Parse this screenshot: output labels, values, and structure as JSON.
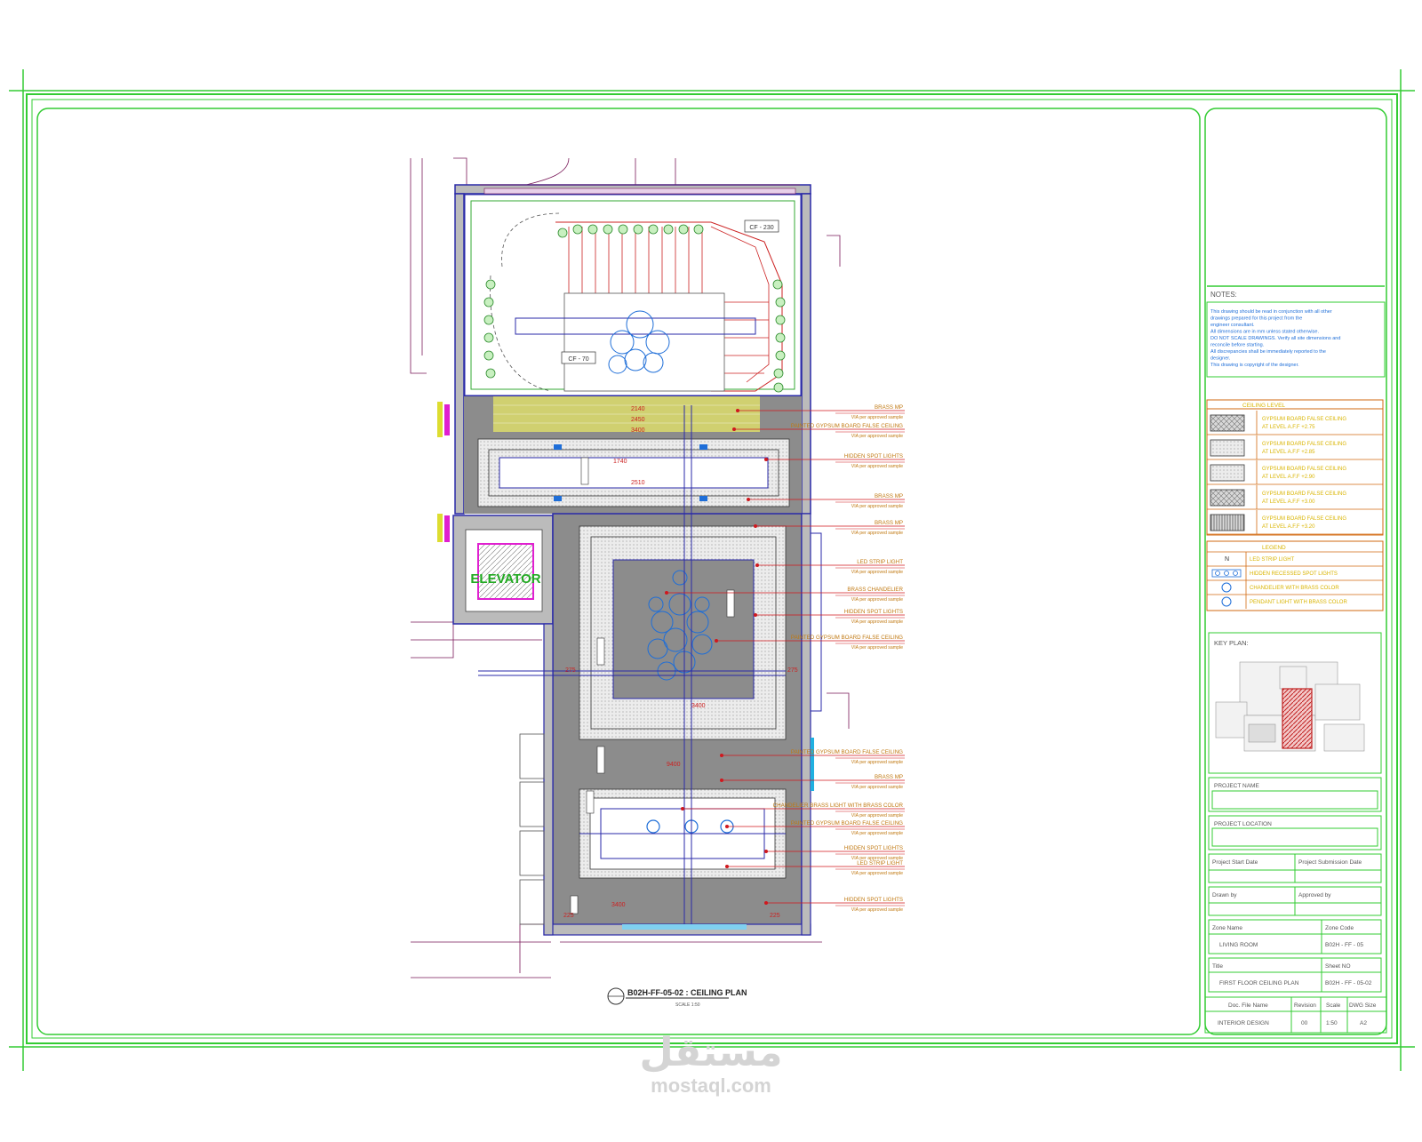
{
  "drawing": {
    "elevator_label": "ELEVATOR",
    "plan_title": "B02H-FF-05-02 : CEILING PLAN",
    "plan_scale": "SCALE 1:50",
    "dimensions": [
      "2140",
      "2450",
      "3400",
      "1740",
      "2510",
      "3400",
      "9400",
      "275",
      "275",
      "225",
      "225",
      "3400"
    ],
    "room_tags": [
      "CF - 230",
      "CF - 70"
    ]
  },
  "annotations": [
    {
      "label": "BRASS MP",
      "note": "VIA per approved sample"
    },
    {
      "label": "PAINTED GYPSUM BOARD FALSE CEILING",
      "note": "VIA per approved sample"
    },
    {
      "label": "HIDDEN SPOT LIGHTS",
      "note": "VIA per approved sample"
    },
    {
      "label": "BRASS MP",
      "note": "VIA per approved sample"
    },
    {
      "label": "BRASS MP",
      "note": "VIA per approved sample"
    },
    {
      "label": "LED STRIP LIGHT",
      "note": "VIA per approved sample"
    },
    {
      "label": "BRASS CHANDELIER",
      "note": "VIA per approved sample"
    },
    {
      "label": "HIDDEN SPOT LIGHTS",
      "note": "VIA per approved sample"
    },
    {
      "label": "PAINTED GYPSUM BOARD FALSE CEILING",
      "note": "VIA per approved sample"
    },
    {
      "label": "PAINTED GYPSUM BOARD FALSE CEILING",
      "note": "VIA per approved sample"
    },
    {
      "label": "BRASS MP",
      "note": "VIA per approved sample"
    },
    {
      "label": "CHANDELIER BRASS LIGHT WITH BRASS COLOR",
      "note": "VIA per approved sample"
    },
    {
      "label": "PAINTED GYPSUM BOARD FALSE CEILING",
      "note": "VIA per approved sample"
    },
    {
      "label": "HIDDEN SPOT LIGHTS",
      "note": "VIA per approved sample"
    },
    {
      "label": "LED STRIP LIGHT",
      "note": "VIA per approved sample"
    },
    {
      "label": "HIDDEN SPOT LIGHTS",
      "note": "VIA per approved sample"
    }
  ],
  "title_block": {
    "notes_title": "NOTES:",
    "notes": [
      "This drawing should be read in conjunction with all other",
      "drawings prepared for this project from the",
      "engineer consultant.",
      "All dimensions are in mm unless stated otherwise.",
      "DO NOT SCALE DRAWINGS. Verify all site dimensions and",
      "reconcile before starting.",
      "All discrepancies shall be immediately reported to the",
      "designer.",
      "This drawing is copyright of the designer."
    ],
    "ceiling_level_title": "CEILING LEVEL",
    "ceiling_levels": [
      {
        "line1": "GYPSUM BOARD FALSE CEILING",
        "line2": "AT LEVEL A.F.F +2.75"
      },
      {
        "line1": "GYPSUM BOARD FALSE CEILING",
        "line2": "AT LEVEL A.F.F +2.85"
      },
      {
        "line1": "GYPSUM BOARD FALSE CEILING",
        "line2": "AT LEVEL A.F.F +2.90"
      },
      {
        "line1": "GYPSUM BOARD FALSE CEILING",
        "line2": "AT LEVEL A.F.F +3.00"
      },
      {
        "line1": "GYPSUM BOARD FALSE CEILING",
        "line2": "AT LEVEL A.F.F +3.20"
      }
    ],
    "legend_title": "LEGEND",
    "legend": [
      {
        "symbol": "N",
        "label": "LED STRIP LIGHT"
      },
      {
        "symbol": "",
        "label": "HIDDEN RECESSED SPOT LIGHTS"
      },
      {
        "symbol": "",
        "label": "CHANDELIER WITH BRASS COLOR"
      },
      {
        "symbol": "",
        "label": "PENDANT LIGHT WITH BRASS COLOR"
      }
    ],
    "key_plan_title": "KEY PLAN:",
    "project_name_label": "PROJECT NAME",
    "project_location_label": "PROJECT LOCATION",
    "start_date_label": "Project Start Date",
    "submission_date_label": "Project Submission Date",
    "drawn_by_label": "Drawn by",
    "approved_by_label": "Approved by",
    "zone_name_label": "Zone Name",
    "zone_name": "LIVING ROOM",
    "zone_code_label": "Zone Code",
    "zone_code": "B02H - FF - 05",
    "title_label": "Title",
    "title_value": "FIRST FLOOR CEILING PLAN",
    "sheet_no_label": "Sheet NO",
    "sheet_no": "B02H - FF - 05-02",
    "doc_file_label": "Doc. File Name",
    "doc_file": "INTERIOR DESIGN",
    "revision_label": "Revision",
    "revision": "00",
    "scale_label": "Scale",
    "scale": "1:50",
    "dwg_size_label": "DWG Size",
    "dwg_size": "A2"
  },
  "watermark": {
    "arabic": "مستقل",
    "latin": "mostaql.com"
  },
  "colors": {
    "frame": "#33cc33",
    "wall": "#2a2aa8",
    "annotation": "#d0181e",
    "ceiling_grey": "#8c8c8c",
    "stair_yellow": "#c8c850",
    "label_text": "#c07810",
    "spot": "#1e6ed8",
    "elevator": "#e020d0"
  }
}
